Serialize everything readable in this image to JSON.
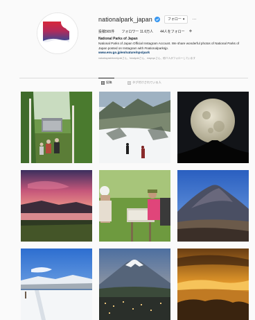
{
  "profile": {
    "username": "nationalpark_japan",
    "follow_button": "フォロー",
    "message_button": "...",
    "more_icon": "more-icon",
    "stats": {
      "posts": "投稿565件",
      "followers": "フォロワー 11.6万人",
      "following": "44人をフォロー"
    },
    "add_icon": "+",
    "display_name": "National Parks of Japan",
    "bio": "National Parks of Japan Official Instagram Account. We share wonderful photos of National Parks of Japan posted on Instagram with #nationalparksjp.",
    "link": "www.env.go.jp/en/nature/nps/park",
    "followed_by": "nakabayashitoshiyukiさん、fukaiyukiさん、mayuyuさん、他77人がフォローしています"
  },
  "tabs": [
    {
      "label": "投稿",
      "icon": "grid-icon",
      "active": true
    },
    {
      "label": "タグ付けされている人",
      "icon": "tag-icon",
      "active": false
    }
  ],
  "grid": {
    "posts": [
      {
        "id": "post-1",
        "subject": "forest-hikers"
      },
      {
        "id": "post-2",
        "subject": "snow-mountain-hikers"
      },
      {
        "id": "post-3",
        "subject": "full-moon"
      },
      {
        "id": "post-4",
        "subject": "sunset-lake"
      },
      {
        "id": "post-5",
        "subject": "hikers-at-signboard"
      },
      {
        "id": "post-6",
        "subject": "volcano"
      },
      {
        "id": "post-7",
        "subject": "winter-snowfield"
      },
      {
        "id": "post-8",
        "subject": "mount-fuji-town"
      },
      {
        "id": "post-9",
        "subject": "golden-cloud-sea"
      }
    ]
  },
  "colors": {
    "link": "#00376b",
    "verified": "#3897f0",
    "accent_red": "#d7283a",
    "accent_blue": "#2b4c9a"
  }
}
